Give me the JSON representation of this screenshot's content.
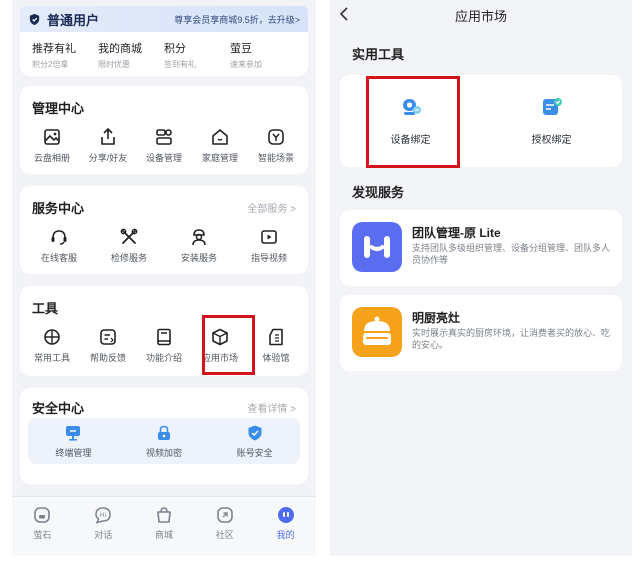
{
  "left": {
    "member": {
      "title": "普通用户",
      "promo": "尊享会员享商城9.5折，去升级>"
    },
    "perks": [
      {
        "title": "推荐有礼",
        "sub": "积分2倍拿"
      },
      {
        "title": "我的商城",
        "sub": "限时优惠"
      },
      {
        "title": "积分",
        "sub": "签到有礼"
      },
      {
        "title": "萤豆",
        "sub": "速来参加"
      }
    ],
    "management": {
      "title": "管理中心",
      "items": [
        {
          "label": "云盘相册",
          "icon": "photo-album-icon"
        },
        {
          "label": "分享/好友",
          "icon": "share-icon"
        },
        {
          "label": "设备管理",
          "icon": "device-manage-icon"
        },
        {
          "label": "家庭管理",
          "icon": "home-icon"
        },
        {
          "label": "智能场景",
          "icon": "smart-scene-icon"
        }
      ]
    },
    "service": {
      "title": "服务中心",
      "link": "全部服务 >",
      "items": [
        {
          "label": "在线客服",
          "icon": "headset-icon"
        },
        {
          "label": "检修服务",
          "icon": "wrench-icon"
        },
        {
          "label": "安装服务",
          "icon": "installer-icon"
        },
        {
          "label": "指导视频",
          "icon": "play-video-icon"
        }
      ]
    },
    "tools": {
      "title": "工具",
      "items": [
        {
          "label": "常用工具",
          "icon": "globe-icon"
        },
        {
          "label": "帮助反馈",
          "icon": "feedback-icon"
        },
        {
          "label": "功能介绍",
          "icon": "book-icon"
        },
        {
          "label": "应用市场",
          "icon": "app-market-cube-icon"
        },
        {
          "label": "体验馆",
          "icon": "experience-hall-icon"
        }
      ]
    },
    "security": {
      "title": "安全中心",
      "link": "查看详情 >",
      "items": [
        {
          "label": "终端管理",
          "icon": "monitor-icon"
        },
        {
          "label": "视频加密",
          "icon": "lock-icon"
        },
        {
          "label": "账号安全",
          "icon": "shield-check-icon"
        }
      ]
    },
    "tabbar": [
      {
        "label": "萤石",
        "icon": "ezviz-icon"
      },
      {
        "label": "对话",
        "icon": "chat-icon"
      },
      {
        "label": "商城",
        "icon": "shop-bag-icon"
      },
      {
        "label": "社区",
        "icon": "community-icon"
      },
      {
        "label": "我的",
        "icon": "me-icon"
      }
    ]
  },
  "right": {
    "nav_title": "应用市场",
    "section_tools": "实用工具",
    "tools": [
      {
        "label": "设备绑定",
        "icon": "device-bind-icon"
      },
      {
        "label": "授权绑定",
        "icon": "auth-bind-icon"
      }
    ],
    "section_discover": "发现服务",
    "services": [
      {
        "title": "团队管理-原 Lite",
        "desc": "支持团队多级组织管理、设备分组管理、团队多人员协作等",
        "icon": "team-manage-icon"
      },
      {
        "title": "明厨亮灶",
        "desc": "实时展示真实的厨房环境，让消费者买的放心、吃的安心。",
        "icon": "kitchen-pot-icon"
      }
    ]
  },
  "colors": {
    "accent": "#4f6bf0",
    "highlight": "#d4141b",
    "team_icon": "#5a6cf0",
    "kitchen_icon": "#f7a21b"
  }
}
